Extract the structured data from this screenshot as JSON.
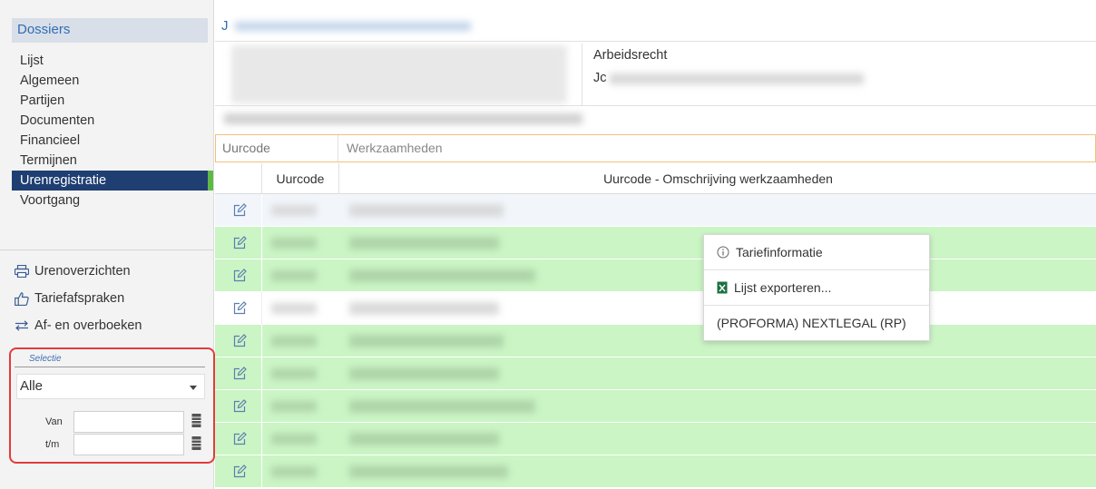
{
  "sidebar": {
    "header": "Dossiers",
    "nav": [
      {
        "label": "Lijst",
        "active": false
      },
      {
        "label": "Algemeen",
        "active": false
      },
      {
        "label": "Partijen",
        "active": false
      },
      {
        "label": "Documenten",
        "active": false
      },
      {
        "label": "Financieel",
        "active": false
      },
      {
        "label": "Termijnen",
        "active": false
      },
      {
        "label": "Urenregistratie",
        "active": true
      },
      {
        "label": "Voortgang",
        "active": false
      }
    ],
    "actions": [
      {
        "label": "Urenoverzichten",
        "icon": "print-icon"
      },
      {
        "label": "Tariefafspraken",
        "icon": "thumbs-up-icon"
      },
      {
        "label": "Af- en overboeken",
        "icon": "transfer-arrows-icon"
      }
    ],
    "selectie": {
      "legend": "Selectie",
      "dropdown_value": "Alle",
      "van_label": "Van",
      "tm_label": "t/m"
    }
  },
  "main": {
    "tab_title": "J",
    "info": {
      "right_line1": "Arbeidsrecht",
      "right_line2": "Jc"
    },
    "filter": {
      "col1": "Uurcode",
      "col2": "Werkzaamheden"
    },
    "grid": {
      "header_code": "Uurcode",
      "header_desc": "Uurcode - Omschrijving werkzaamheden",
      "rows": [
        {
          "style": "light"
        },
        {
          "style": "green"
        },
        {
          "style": "green"
        },
        {
          "style": "white"
        },
        {
          "style": "green"
        },
        {
          "style": "green"
        },
        {
          "style": "green"
        },
        {
          "style": "green"
        },
        {
          "style": "green"
        }
      ]
    }
  },
  "context_menu": {
    "items": [
      {
        "label": "Tariefinformatie",
        "icon": "info-icon"
      },
      {
        "label": "Lijst exporteren...",
        "icon": "excel-icon"
      },
      {
        "label": "(PROFORMA) NEXTLEGAL (RP)",
        "icon": ""
      }
    ]
  },
  "colors": {
    "active_nav": "#1f3f73",
    "active_nav_accent": "#5fb947",
    "row_green": "#cbf5c5",
    "selection_border": "#e23b3b",
    "link_blue": "#2f6db5"
  }
}
